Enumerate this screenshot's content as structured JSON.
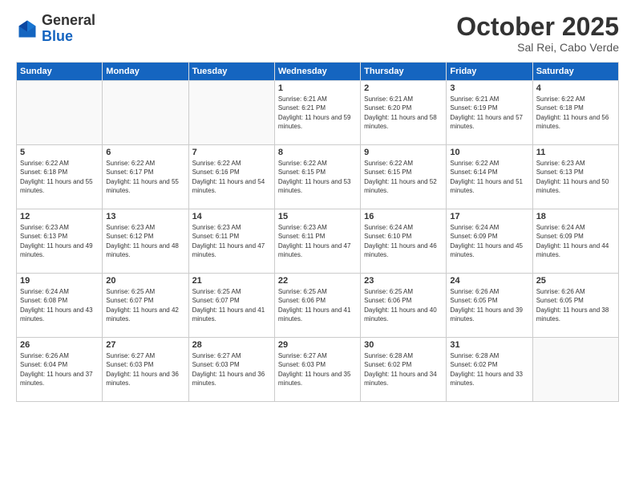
{
  "header": {
    "logo_general": "General",
    "logo_blue": "Blue",
    "month_title": "October 2025",
    "location": "Sal Rei, Cabo Verde"
  },
  "weekdays": [
    "Sunday",
    "Monday",
    "Tuesday",
    "Wednesday",
    "Thursday",
    "Friday",
    "Saturday"
  ],
  "weeks": [
    [
      {
        "day": "",
        "sunrise": "",
        "sunset": "",
        "daylight": ""
      },
      {
        "day": "",
        "sunrise": "",
        "sunset": "",
        "daylight": ""
      },
      {
        "day": "",
        "sunrise": "",
        "sunset": "",
        "daylight": ""
      },
      {
        "day": "1",
        "sunrise": "Sunrise: 6:21 AM",
        "sunset": "Sunset: 6:21 PM",
        "daylight": "Daylight: 11 hours and 59 minutes."
      },
      {
        "day": "2",
        "sunrise": "Sunrise: 6:21 AM",
        "sunset": "Sunset: 6:20 PM",
        "daylight": "Daylight: 11 hours and 58 minutes."
      },
      {
        "day": "3",
        "sunrise": "Sunrise: 6:21 AM",
        "sunset": "Sunset: 6:19 PM",
        "daylight": "Daylight: 11 hours and 57 minutes."
      },
      {
        "day": "4",
        "sunrise": "Sunrise: 6:22 AM",
        "sunset": "Sunset: 6:18 PM",
        "daylight": "Daylight: 11 hours and 56 minutes."
      }
    ],
    [
      {
        "day": "5",
        "sunrise": "Sunrise: 6:22 AM",
        "sunset": "Sunset: 6:18 PM",
        "daylight": "Daylight: 11 hours and 55 minutes."
      },
      {
        "day": "6",
        "sunrise": "Sunrise: 6:22 AM",
        "sunset": "Sunset: 6:17 PM",
        "daylight": "Daylight: 11 hours and 55 minutes."
      },
      {
        "day": "7",
        "sunrise": "Sunrise: 6:22 AM",
        "sunset": "Sunset: 6:16 PM",
        "daylight": "Daylight: 11 hours and 54 minutes."
      },
      {
        "day": "8",
        "sunrise": "Sunrise: 6:22 AM",
        "sunset": "Sunset: 6:15 PM",
        "daylight": "Daylight: 11 hours and 53 minutes."
      },
      {
        "day": "9",
        "sunrise": "Sunrise: 6:22 AM",
        "sunset": "Sunset: 6:15 PM",
        "daylight": "Daylight: 11 hours and 52 minutes."
      },
      {
        "day": "10",
        "sunrise": "Sunrise: 6:22 AM",
        "sunset": "Sunset: 6:14 PM",
        "daylight": "Daylight: 11 hours and 51 minutes."
      },
      {
        "day": "11",
        "sunrise": "Sunrise: 6:23 AM",
        "sunset": "Sunset: 6:13 PM",
        "daylight": "Daylight: 11 hours and 50 minutes."
      }
    ],
    [
      {
        "day": "12",
        "sunrise": "Sunrise: 6:23 AM",
        "sunset": "Sunset: 6:13 PM",
        "daylight": "Daylight: 11 hours and 49 minutes."
      },
      {
        "day": "13",
        "sunrise": "Sunrise: 6:23 AM",
        "sunset": "Sunset: 6:12 PM",
        "daylight": "Daylight: 11 hours and 48 minutes."
      },
      {
        "day": "14",
        "sunrise": "Sunrise: 6:23 AM",
        "sunset": "Sunset: 6:11 PM",
        "daylight": "Daylight: 11 hours and 47 minutes."
      },
      {
        "day": "15",
        "sunrise": "Sunrise: 6:23 AM",
        "sunset": "Sunset: 6:11 PM",
        "daylight": "Daylight: 11 hours and 47 minutes."
      },
      {
        "day": "16",
        "sunrise": "Sunrise: 6:24 AM",
        "sunset": "Sunset: 6:10 PM",
        "daylight": "Daylight: 11 hours and 46 minutes."
      },
      {
        "day": "17",
        "sunrise": "Sunrise: 6:24 AM",
        "sunset": "Sunset: 6:09 PM",
        "daylight": "Daylight: 11 hours and 45 minutes."
      },
      {
        "day": "18",
        "sunrise": "Sunrise: 6:24 AM",
        "sunset": "Sunset: 6:09 PM",
        "daylight": "Daylight: 11 hours and 44 minutes."
      }
    ],
    [
      {
        "day": "19",
        "sunrise": "Sunrise: 6:24 AM",
        "sunset": "Sunset: 6:08 PM",
        "daylight": "Daylight: 11 hours and 43 minutes."
      },
      {
        "day": "20",
        "sunrise": "Sunrise: 6:25 AM",
        "sunset": "Sunset: 6:07 PM",
        "daylight": "Daylight: 11 hours and 42 minutes."
      },
      {
        "day": "21",
        "sunrise": "Sunrise: 6:25 AM",
        "sunset": "Sunset: 6:07 PM",
        "daylight": "Daylight: 11 hours and 41 minutes."
      },
      {
        "day": "22",
        "sunrise": "Sunrise: 6:25 AM",
        "sunset": "Sunset: 6:06 PM",
        "daylight": "Daylight: 11 hours and 41 minutes."
      },
      {
        "day": "23",
        "sunrise": "Sunrise: 6:25 AM",
        "sunset": "Sunset: 6:06 PM",
        "daylight": "Daylight: 11 hours and 40 minutes."
      },
      {
        "day": "24",
        "sunrise": "Sunrise: 6:26 AM",
        "sunset": "Sunset: 6:05 PM",
        "daylight": "Daylight: 11 hours and 39 minutes."
      },
      {
        "day": "25",
        "sunrise": "Sunrise: 6:26 AM",
        "sunset": "Sunset: 6:05 PM",
        "daylight": "Daylight: 11 hours and 38 minutes."
      }
    ],
    [
      {
        "day": "26",
        "sunrise": "Sunrise: 6:26 AM",
        "sunset": "Sunset: 6:04 PM",
        "daylight": "Daylight: 11 hours and 37 minutes."
      },
      {
        "day": "27",
        "sunrise": "Sunrise: 6:27 AM",
        "sunset": "Sunset: 6:03 PM",
        "daylight": "Daylight: 11 hours and 36 minutes."
      },
      {
        "day": "28",
        "sunrise": "Sunrise: 6:27 AM",
        "sunset": "Sunset: 6:03 PM",
        "daylight": "Daylight: 11 hours and 36 minutes."
      },
      {
        "day": "29",
        "sunrise": "Sunrise: 6:27 AM",
        "sunset": "Sunset: 6:03 PM",
        "daylight": "Daylight: 11 hours and 35 minutes."
      },
      {
        "day": "30",
        "sunrise": "Sunrise: 6:28 AM",
        "sunset": "Sunset: 6:02 PM",
        "daylight": "Daylight: 11 hours and 34 minutes."
      },
      {
        "day": "31",
        "sunrise": "Sunrise: 6:28 AM",
        "sunset": "Sunset: 6:02 PM",
        "daylight": "Daylight: 11 hours and 33 minutes."
      },
      {
        "day": "",
        "sunrise": "",
        "sunset": "",
        "daylight": ""
      }
    ]
  ]
}
